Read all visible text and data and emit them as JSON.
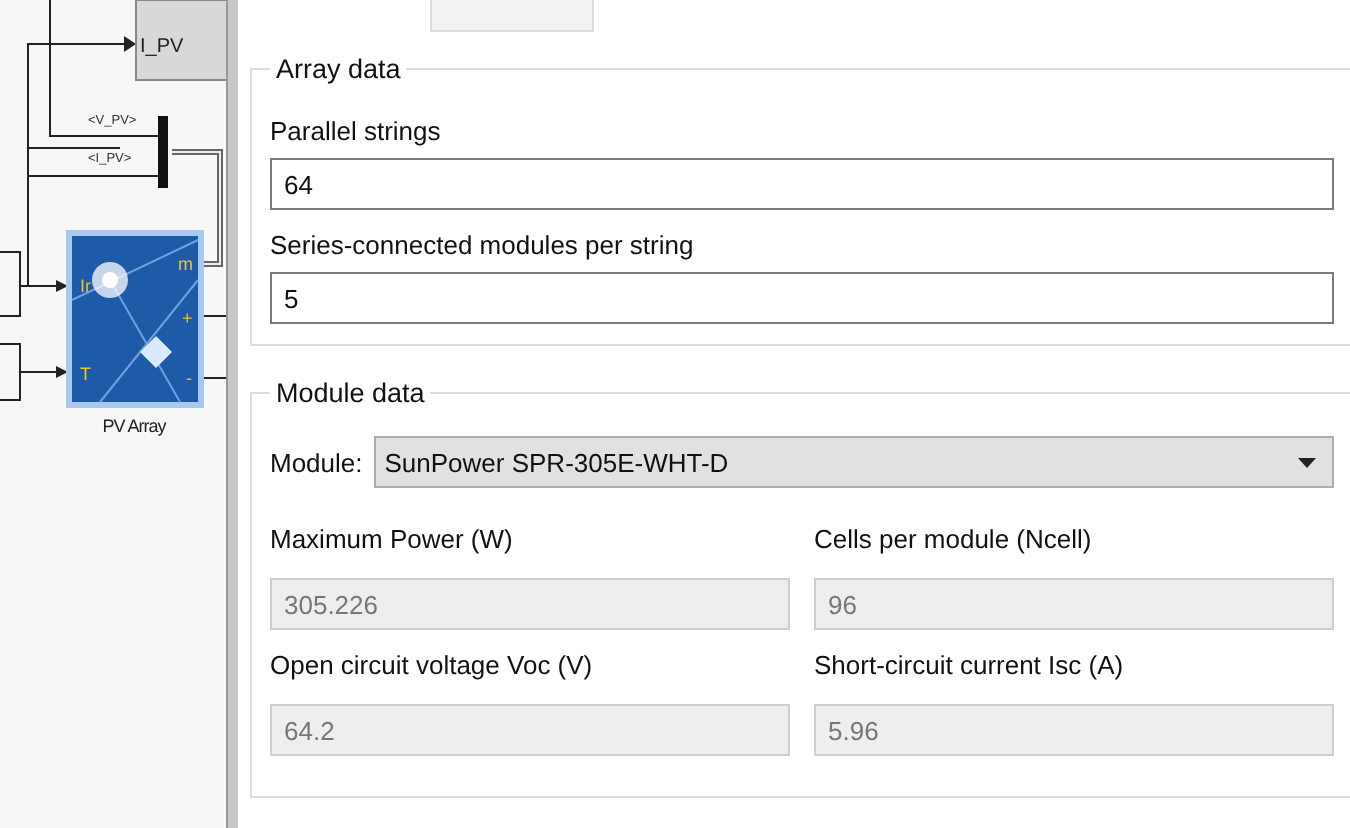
{
  "diagram": {
    "goto_label": "I_PV",
    "bus_signals": [
      "<V_PV>",
      "<I_PV>"
    ],
    "pv_block": {
      "name": "PV Array",
      "inputs": [
        "Ir",
        "T"
      ],
      "outputs": [
        "m",
        "+",
        "-"
      ]
    }
  },
  "array_data": {
    "title": "Array data",
    "fields": [
      {
        "label": "Parallel strings",
        "value": "64"
      },
      {
        "label": "Series-connected modules per string",
        "value": "5"
      }
    ]
  },
  "module_data": {
    "title": "Module data",
    "module": {
      "label": "Module:",
      "value": "SunPower SPR-305E-WHT-D"
    },
    "params": [
      {
        "label": "Maximum Power (W)",
        "value": "305.226",
        "disabled": true
      },
      {
        "label": "Cells per module (Ncell)",
        "value": "96",
        "disabled": true
      },
      {
        "label": "Open circuit voltage  Voc (V)",
        "value": "64.2",
        "disabled": true
      },
      {
        "label": "Short-circuit current Isc (A)",
        "value": "5.96",
        "disabled": true
      }
    ]
  }
}
